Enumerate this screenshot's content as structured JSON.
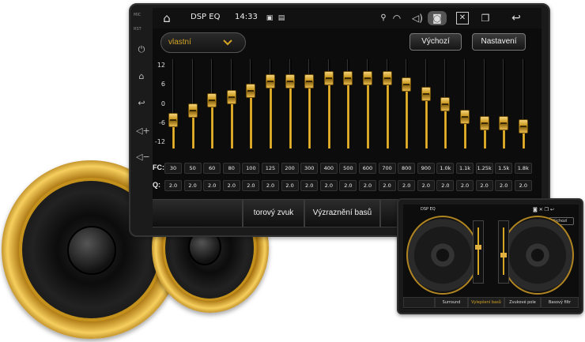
{
  "side_keys": {
    "mic_label": "MIC",
    "rst_label": "RST"
  },
  "status_bar": {
    "app_title": "DSP EQ",
    "time": "14:33"
  },
  "preset": {
    "selected": "vlastní"
  },
  "buttons": {
    "default_label": "Výchozí",
    "settings_label": "Nastavení"
  },
  "y_axis": {
    "labels": [
      "12",
      "6",
      "0",
      "-6",
      "-12"
    ]
  },
  "eq": {
    "fc_label": "FC:",
    "q_label": "Q:",
    "bands": [
      {
        "fc": "30",
        "q": "2.0",
        "gain": -5
      },
      {
        "fc": "50",
        "q": "2.0",
        "gain": -2
      },
      {
        "fc": "60",
        "q": "2.0",
        "gain": 1
      },
      {
        "fc": "80",
        "q": "2.0",
        "gain": 2
      },
      {
        "fc": "100",
        "q": "2.0",
        "gain": 4
      },
      {
        "fc": "125",
        "q": "2.0",
        "gain": 7
      },
      {
        "fc": "200",
        "q": "2.0",
        "gain": 7
      },
      {
        "fc": "300",
        "q": "2.0",
        "gain": 7
      },
      {
        "fc": "400",
        "q": "2.0",
        "gain": 8
      },
      {
        "fc": "500",
        "q": "2.0",
        "gain": 8
      },
      {
        "fc": "600",
        "q": "2.0",
        "gain": 8
      },
      {
        "fc": "700",
        "q": "2.0",
        "gain": 8
      },
      {
        "fc": "800",
        "q": "2.0",
        "gain": 6
      },
      {
        "fc": "900",
        "q": "2.0",
        "gain": 3
      },
      {
        "fc": "1.0k",
        "q": "2.0",
        "gain": 0
      },
      {
        "fc": "1.1k",
        "q": "2.0",
        "gain": -4
      },
      {
        "fc": "1.25k",
        "q": "2.0",
        "gain": -6
      },
      {
        "fc": "1.5k",
        "q": "2.0",
        "gain": -6
      },
      {
        "fc": "1.8k",
        "q": "2.0",
        "gain": -7
      }
    ]
  },
  "tabs": [
    "torový zvuk",
    "Výzraznění basů"
  ],
  "tablet": {
    "title": "DSP EQ",
    "default_label": "Výchozí",
    "tabs": [
      "Surround",
      "Vylepšení basů",
      "Zvukové pole",
      "Basový filtr"
    ]
  }
}
